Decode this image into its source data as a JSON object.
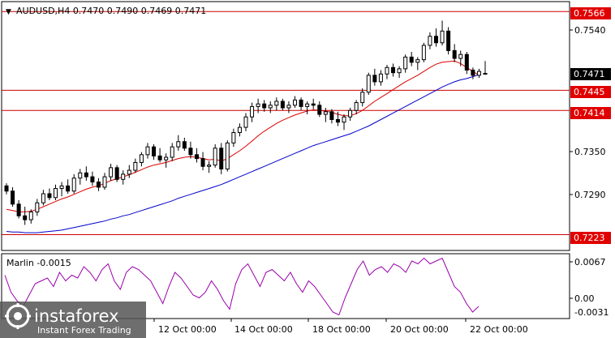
{
  "header": {
    "symbol_line": "AUDUSD,H4  0.7470 0.7490 0.7469 0.7471",
    "collapse_glyph": "▼"
  },
  "colors": {
    "bull_candle": "#ffffff",
    "bear_candle": "#000000",
    "level_line": "#cc0000",
    "level_tag": "#e00000",
    "fast_ma": "#dd0000",
    "slow_ma": "#0000cc",
    "oscillator": "#9900aa",
    "current_tag": "#000000",
    "axis": "#000000"
  },
  "price_axis": {
    "ticks": [
      "0.7540",
      "0.7350",
      "0.7290"
    ],
    "level_tags": [
      "0.7566",
      "0.7445",
      "0.7414",
      "0.7223"
    ],
    "current_price": "0.7471"
  },
  "indicator": {
    "label": "Marlin -0.0015",
    "ticks": [
      "0.0067",
      "0.00",
      "-0.0031"
    ]
  },
  "time_axis": {
    "labels": [
      "12 Oct 00:00",
      "14 Oct 00:00",
      "18 Oct 00:00",
      "20 Oct 00:00",
      "22 Oct 00:00"
    ]
  },
  "watermark": {
    "brand": "instaforex",
    "tagline": "Instant Forex Trading"
  },
  "chart_data": {
    "type": "candlestick",
    "symbol": "AUDUSD",
    "timeframe": "H4",
    "last_bar": {
      "open": 0.747,
      "high": 0.749,
      "low": 0.7469,
      "close": 0.7471
    },
    "price_range": [
      0.72,
      0.758
    ],
    "horizontal_levels": [
      0.7566,
      0.7445,
      0.7414,
      0.7223
    ],
    "candles": [
      [
        0.7298,
        0.7302,
        0.7285,
        0.729
      ],
      [
        0.729,
        0.7296,
        0.7266,
        0.727
      ],
      [
        0.727,
        0.7276,
        0.7248,
        0.7252
      ],
      [
        0.7252,
        0.7266,
        0.7238,
        0.7246
      ],
      [
        0.7246,
        0.7262,
        0.724,
        0.7258
      ],
      [
        0.7258,
        0.7278,
        0.7252,
        0.7272
      ],
      [
        0.7272,
        0.7292,
        0.7268,
        0.7286
      ],
      [
        0.7286,
        0.7294,
        0.7276,
        0.728
      ],
      [
        0.728,
        0.73,
        0.7276,
        0.7294
      ],
      [
        0.7294,
        0.7304,
        0.7282,
        0.7298
      ],
      [
        0.7298,
        0.7308,
        0.7286,
        0.729
      ],
      [
        0.729,
        0.7316,
        0.7286,
        0.731
      ],
      [
        0.731,
        0.7324,
        0.73,
        0.7318
      ],
      [
        0.7318,
        0.7328,
        0.7306,
        0.7312
      ],
      [
        0.7312,
        0.732,
        0.7298,
        0.7304
      ],
      [
        0.7304,
        0.731,
        0.729,
        0.7296
      ],
      [
        0.7296,
        0.7318,
        0.7292,
        0.7312
      ],
      [
        0.7312,
        0.7332,
        0.7306,
        0.7326
      ],
      [
        0.7326,
        0.733,
        0.7304,
        0.7308
      ],
      [
        0.7308,
        0.7322,
        0.73,
        0.7316
      ],
      [
        0.7316,
        0.733,
        0.731,
        0.7322
      ],
      [
        0.7322,
        0.734,
        0.7318,
        0.7334
      ],
      [
        0.7334,
        0.735,
        0.7328,
        0.7346
      ],
      [
        0.7346,
        0.7364,
        0.734,
        0.7358
      ],
      [
        0.7358,
        0.7362,
        0.7338,
        0.7344
      ],
      [
        0.7344,
        0.7356,
        0.7334,
        0.7338
      ],
      [
        0.7338,
        0.7348,
        0.7326,
        0.7342
      ],
      [
        0.7342,
        0.7364,
        0.7336,
        0.7358
      ],
      [
        0.7358,
        0.7376,
        0.7352,
        0.7366
      ],
      [
        0.7366,
        0.7372,
        0.7352,
        0.7356
      ],
      [
        0.7356,
        0.7366,
        0.734,
        0.7346
      ],
      [
        0.7346,
        0.7356,
        0.7334,
        0.734
      ],
      [
        0.734,
        0.735,
        0.7322,
        0.7328
      ],
      [
        0.7328,
        0.7336,
        0.7318,
        0.733
      ],
      [
        0.733,
        0.7362,
        0.7326,
        0.7356
      ],
      [
        0.7356,
        0.7364,
        0.7316,
        0.7324
      ],
      [
        0.7324,
        0.7368,
        0.732,
        0.7364
      ],
      [
        0.7364,
        0.7386,
        0.7358,
        0.738
      ],
      [
        0.738,
        0.7394,
        0.7374,
        0.7388
      ],
      [
        0.7388,
        0.741,
        0.7382,
        0.7404
      ],
      [
        0.7404,
        0.7426,
        0.7396,
        0.742
      ],
      [
        0.742,
        0.7432,
        0.741,
        0.7424
      ],
      [
        0.7424,
        0.743,
        0.7412,
        0.7418
      ],
      [
        0.7418,
        0.7428,
        0.741,
        0.7422
      ],
      [
        0.7422,
        0.7434,
        0.7414,
        0.7428
      ],
      [
        0.7428,
        0.7432,
        0.7414,
        0.7418
      ],
      [
        0.7418,
        0.7428,
        0.741,
        0.7422
      ],
      [
        0.7422,
        0.7436,
        0.7418,
        0.743
      ],
      [
        0.743,
        0.7434,
        0.7414,
        0.742
      ],
      [
        0.742,
        0.7428,
        0.7408,
        0.7424
      ],
      [
        0.7424,
        0.7432,
        0.7416,
        0.7422
      ],
      [
        0.7422,
        0.7428,
        0.7404,
        0.7408
      ],
      [
        0.7408,
        0.7418,
        0.7396,
        0.7412
      ],
      [
        0.7412,
        0.7416,
        0.7394,
        0.74
      ],
      [
        0.74,
        0.7412,
        0.739,
        0.7396
      ],
      [
        0.7396,
        0.7408,
        0.7384,
        0.7404
      ],
      [
        0.7404,
        0.7418,
        0.7398,
        0.7414
      ],
      [
        0.7414,
        0.743,
        0.7408,
        0.7426
      ],
      [
        0.7426,
        0.7448,
        0.742,
        0.7442
      ],
      [
        0.7442,
        0.7472,
        0.7438,
        0.7468
      ],
      [
        0.7468,
        0.7478,
        0.7452,
        0.7458
      ],
      [
        0.7458,
        0.7476,
        0.7452,
        0.747
      ],
      [
        0.747,
        0.7484,
        0.7462,
        0.748
      ],
      [
        0.748,
        0.7486,
        0.7466,
        0.7472
      ],
      [
        0.7472,
        0.7482,
        0.7464,
        0.7478
      ],
      [
        0.7478,
        0.75,
        0.7472,
        0.7496
      ],
      [
        0.7496,
        0.7504,
        0.7482,
        0.7488
      ],
      [
        0.7488,
        0.7496,
        0.7476,
        0.7492
      ],
      [
        0.7492,
        0.7518,
        0.7488,
        0.7514
      ],
      [
        0.7514,
        0.7534,
        0.7508,
        0.7528
      ],
      [
        0.7528,
        0.754,
        0.7512,
        0.7518
      ],
      [
        0.7518,
        0.7552,
        0.7514,
        0.7536
      ],
      [
        0.7536,
        0.7542,
        0.75,
        0.7506
      ],
      [
        0.7506,
        0.7516,
        0.7488,
        0.7494
      ],
      [
        0.7494,
        0.7506,
        0.7482,
        0.75
      ],
      [
        0.75,
        0.7504,
        0.747,
        0.7476
      ],
      [
        0.7476,
        0.748,
        0.7462,
        0.7468
      ],
      [
        0.7468,
        0.7478,
        0.7464,
        0.7474
      ],
      [
        0.747,
        0.749,
        0.7469,
        0.7471
      ]
    ],
    "fast_ma": [
      0.7262,
      0.726,
      0.7258,
      0.7258,
      0.7259,
      0.7262,
      0.7266,
      0.727,
      0.7274,
      0.7278,
      0.7281,
      0.7285,
      0.7289,
      0.7293,
      0.7296,
      0.7298,
      0.7302,
      0.7306,
      0.7309,
      0.7312,
      0.7315,
      0.7319,
      0.7323,
      0.7327,
      0.733,
      0.7332,
      0.7334,
      0.7337,
      0.734,
      0.7342,
      0.7343,
      0.7342,
      0.734,
      0.7338,
      0.7339,
      0.7336,
      0.734,
      0.7346,
      0.7352,
      0.7359,
      0.7367,
      0.7375,
      0.7382,
      0.7388,
      0.7394,
      0.7399,
      0.7403,
      0.7407,
      0.741,
      0.7413,
      0.7415,
      0.7414,
      0.7413,
      0.7411,
      0.7408,
      0.7406,
      0.7406,
      0.7409,
      0.7414,
      0.7421,
      0.7428,
      0.7434,
      0.744,
      0.7446,
      0.7452,
      0.7458,
      0.7463,
      0.7468,
      0.7474,
      0.748,
      0.7485,
      0.7488,
      0.7489,
      0.749,
      0.7486,
      0.748,
      0.7474,
      0.7468
    ],
    "slow_ma": [
      0.7228,
      0.7227,
      0.7227,
      0.7226,
      0.7226,
      0.7226,
      0.7227,
      0.7228,
      0.7229,
      0.723,
      0.7232,
      0.7234,
      0.7236,
      0.7238,
      0.724,
      0.7242,
      0.7244,
      0.7247,
      0.7249,
      0.7252,
      0.7254,
      0.7257,
      0.726,
      0.7263,
      0.7266,
      0.7269,
      0.7272,
      0.7275,
      0.7279,
      0.7282,
      0.7285,
      0.7288,
      0.7291,
      0.7294,
      0.7297,
      0.73,
      0.7304,
      0.7308,
      0.7312,
      0.7316,
      0.732,
      0.7324,
      0.7328,
      0.7332,
      0.7336,
      0.734,
      0.7344,
      0.7348,
      0.7352,
      0.7356,
      0.736,
      0.7363,
      0.7366,
      0.7369,
      0.7372,
      0.7375,
      0.7378,
      0.7382,
      0.7386,
      0.739,
      0.7395,
      0.74,
      0.7405,
      0.741,
      0.7415,
      0.742,
      0.7425,
      0.743,
      0.7435,
      0.744,
      0.7445,
      0.745,
      0.7454,
      0.7458,
      0.7461,
      0.7463,
      0.7466,
      0.7469
    ],
    "oscillator": {
      "name": "Marlin",
      "value": -0.0015,
      "range": [
        -0.0035,
        0.0075
      ],
      "values": [
        0.004,
        0.001,
        -0.0005,
        -0.0015,
        0.0005,
        0.0025,
        0.003,
        0.0035,
        0.002,
        0.0045,
        0.003,
        0.004,
        0.0035,
        0.0055,
        0.0045,
        0.003,
        0.005,
        0.006,
        0.003,
        0.0015,
        0.0045,
        0.0055,
        0.005,
        0.004,
        0.003,
        0.001,
        -0.001,
        0.002,
        0.0045,
        0.0035,
        0.002,
        0.0005,
        0.0,
        0.001,
        0.003,
        0.0015,
        -0.0005,
        -0.002,
        0.0025,
        0.005,
        0.006,
        0.004,
        0.002,
        0.0045,
        0.005,
        0.004,
        0.003,
        0.0045,
        0.0025,
        0.001,
        0.003,
        0.002,
        0.0005,
        -0.001,
        -0.0025,
        -0.003,
        0.0,
        0.0025,
        0.005,
        0.0065,
        0.004,
        0.005,
        0.0055,
        0.0045,
        0.006,
        0.0055,
        0.0045,
        0.0065,
        0.006,
        0.007,
        0.006,
        0.0065,
        0.007,
        0.0045,
        0.002,
        0.001,
        -0.001,
        -0.0025,
        -0.0015
      ]
    }
  }
}
